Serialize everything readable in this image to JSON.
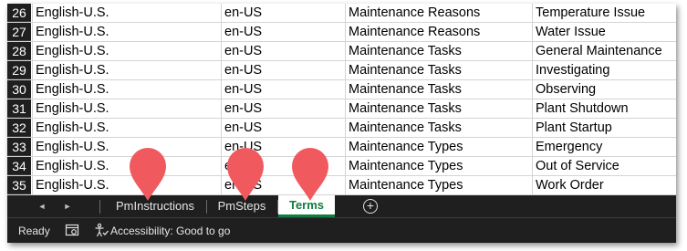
{
  "rows": [
    {
      "num": "26",
      "lang": "English-U.S.",
      "code": "en-US",
      "category": "Maintenance Reasons",
      "term": "Temperature Issue"
    },
    {
      "num": "27",
      "lang": "English-U.S.",
      "code": "en-US",
      "category": "Maintenance Reasons",
      "term": "Water Issue"
    },
    {
      "num": "28",
      "lang": "English-U.S.",
      "code": "en-US",
      "category": "Maintenance Tasks",
      "term": "General Maintenance"
    },
    {
      "num": "29",
      "lang": "English-U.S.",
      "code": "en-US",
      "category": "Maintenance Tasks",
      "term": "Investigating"
    },
    {
      "num": "30",
      "lang": "English-U.S.",
      "code": "en-US",
      "category": "Maintenance Tasks",
      "term": "Observing"
    },
    {
      "num": "31",
      "lang": "English-U.S.",
      "code": "en-US",
      "category": "Maintenance Tasks",
      "term": "Plant Shutdown"
    },
    {
      "num": "32",
      "lang": "English-U.S.",
      "code": "en-US",
      "category": "Maintenance Tasks",
      "term": "Plant Startup"
    },
    {
      "num": "33",
      "lang": "English-U.S.",
      "code": "en-US",
      "category": "Maintenance Types",
      "term": "Emergency"
    },
    {
      "num": "34",
      "lang": "English-U.S.",
      "code": "en-US",
      "category": "Maintenance Types",
      "term": "Out of Service"
    },
    {
      "num": "35",
      "lang": "English-U.S.",
      "code": "en-US",
      "category": "Maintenance Types",
      "term": "Work Order"
    }
  ],
  "sheet_tabs": [
    {
      "label": "PmInstructions",
      "active": false
    },
    {
      "label": "PmSteps",
      "active": false
    },
    {
      "label": "Terms",
      "active": true
    }
  ],
  "tab_nav": {
    "prev_icon": "◄",
    "next_icon": "►",
    "add_icon": "+"
  },
  "status": {
    "ready": "Ready",
    "accessibility": "Accessibility: Good to go"
  },
  "colors": {
    "accent_green": "#107c41",
    "marker_red": "#f05a5f",
    "dark_chrome": "#1f1f1f"
  }
}
